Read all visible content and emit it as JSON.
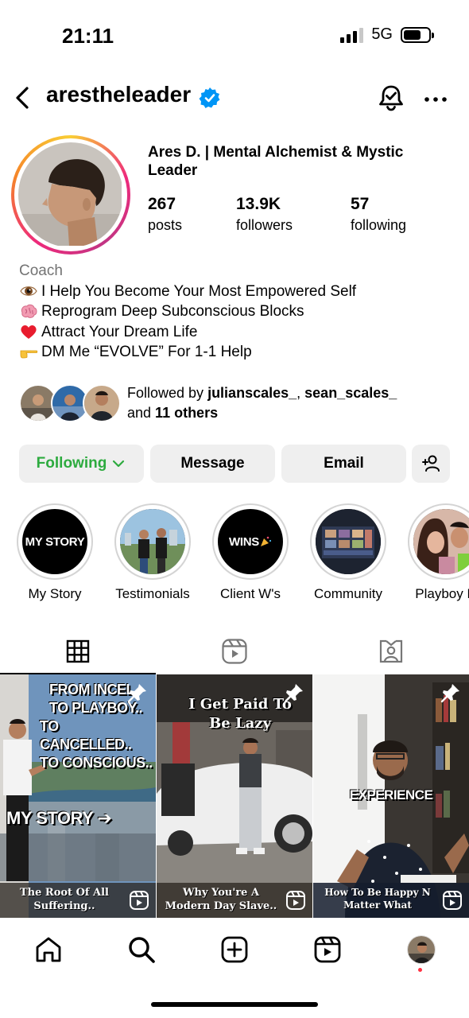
{
  "status_bar": {
    "time": "21:11",
    "network": "5G"
  },
  "header": {
    "username": "arestheleader"
  },
  "profile": {
    "display_name": "Ares D. | Mental Alchemist & Mystic Leader",
    "stats": [
      {
        "value": "267",
        "label": "posts"
      },
      {
        "value": "13.9K",
        "label": "followers"
      },
      {
        "value": "57",
        "label": "following"
      }
    ],
    "category": "Coach",
    "bio_lines": [
      {
        "icon": "eye-emoji",
        "text": "I Help You Become Your Most Empowered Self"
      },
      {
        "icon": "brain-emoji",
        "text": "Reprogram Deep Subconscious Blocks"
      },
      {
        "icon": "red-heart-emoji",
        "text": "Attract Your Dream Life"
      },
      {
        "icon": "pointing-hand-emoji",
        "text": "DM Me “EVOLVE” For 1-1 Help"
      }
    ],
    "followed_by": {
      "prefix": "Followed by ",
      "user1": "julianscales_",
      "sep": ", ",
      "user2": "sean_scales_",
      "and": " and ",
      "others": "11 others"
    }
  },
  "actions": {
    "following": "Following",
    "message": "Message",
    "email": "Email"
  },
  "highlights": [
    {
      "label": "My Story",
      "cover_text": "MY STORY"
    },
    {
      "label": "Testimonials",
      "cover_text": ""
    },
    {
      "label": "Client W's",
      "cover_text": "WINS"
    },
    {
      "label": "Community",
      "cover_text": ""
    },
    {
      "label": "Playboy D",
      "cover_text": ""
    }
  ],
  "tabs": [
    "grid-icon",
    "reels-icon",
    "tagged-icon"
  ],
  "posts": [
    {
      "overlay_lines": [
        "FROM INCEL",
        "TO PLAYBOY..",
        "TO CANCELLED..",
        "TO CONSCIOUS.."
      ],
      "overlay_bottom": "MY STORY ➔",
      "caption": "The Root Of All Suffering.."
    },
    {
      "overlay_lines": [
        "I Get Paid To",
        "Be Lazy"
      ],
      "overlay_bottom": "",
      "caption": "Why You're A Modern Day Slave.."
    },
    {
      "overlay_lines": [
        "EXPERIENCE"
      ],
      "overlay_bottom": "",
      "caption": "How To Be Happy N Matter What"
    }
  ],
  "colors": {
    "following_green": "#2dab3f",
    "verified_blue": "#0095f6",
    "button_bg": "#efefef",
    "notification_dot": "#ff3040"
  }
}
